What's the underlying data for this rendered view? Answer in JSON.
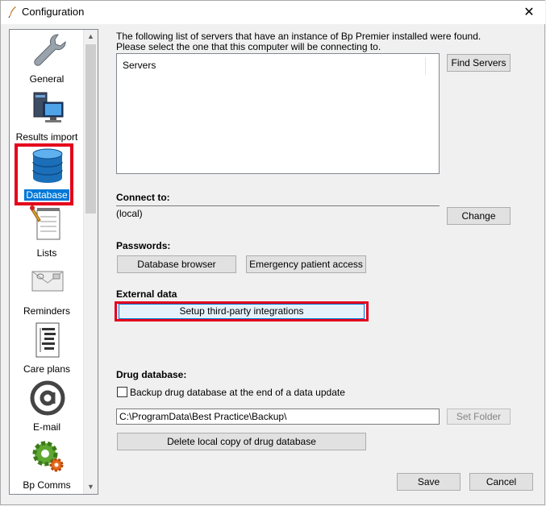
{
  "window": {
    "title": "Configuration",
    "close_glyph": "✕"
  },
  "sidebar": {
    "items": [
      {
        "label": "General",
        "icon": "wrench-icon",
        "selected": false
      },
      {
        "label": "Results import",
        "icon": "computer-icon",
        "selected": false
      },
      {
        "label": "Database",
        "icon": "database-icon",
        "selected": true
      },
      {
        "label": "Lists",
        "icon": "notepad-icon",
        "selected": false
      },
      {
        "label": "Reminders",
        "icon": "envelope-icon",
        "selected": false
      },
      {
        "label": "Care plans",
        "icon": "document-tree-icon",
        "selected": false
      },
      {
        "label": "E-mail",
        "icon": "at-sign-icon",
        "selected": false
      },
      {
        "label": "Bp Comms",
        "icon": "gears-icon",
        "selected": false
      }
    ]
  },
  "servers": {
    "intro_line1": "The following list of servers that have an instance of Bp Premier installed were found.",
    "intro_line2": "Please select the one that this computer will be connecting to.",
    "column_header": "Servers",
    "find_button": "Find Servers"
  },
  "connect": {
    "heading": "Connect to:",
    "value": "(local)",
    "change_button": "Change"
  },
  "passwords": {
    "heading": "Passwords:",
    "db_browser_button": "Database browser",
    "emergency_button": "Emergency patient access"
  },
  "external": {
    "heading": "External data",
    "setup_button": "Setup third-party integrations"
  },
  "drug": {
    "heading": "Drug database:",
    "backup_label": "Backup drug database at the end of a data update",
    "backup_checked": false,
    "path_value": "C:\\ProgramData\\Best Practice\\Backup\\",
    "set_folder_button": "Set Folder",
    "delete_button": "Delete local copy of drug database"
  },
  "footer": {
    "save_button": "Save",
    "cancel_button": "Cancel"
  },
  "colors": {
    "highlight_red": "#e4001b",
    "selection_blue": "#0078d7"
  }
}
